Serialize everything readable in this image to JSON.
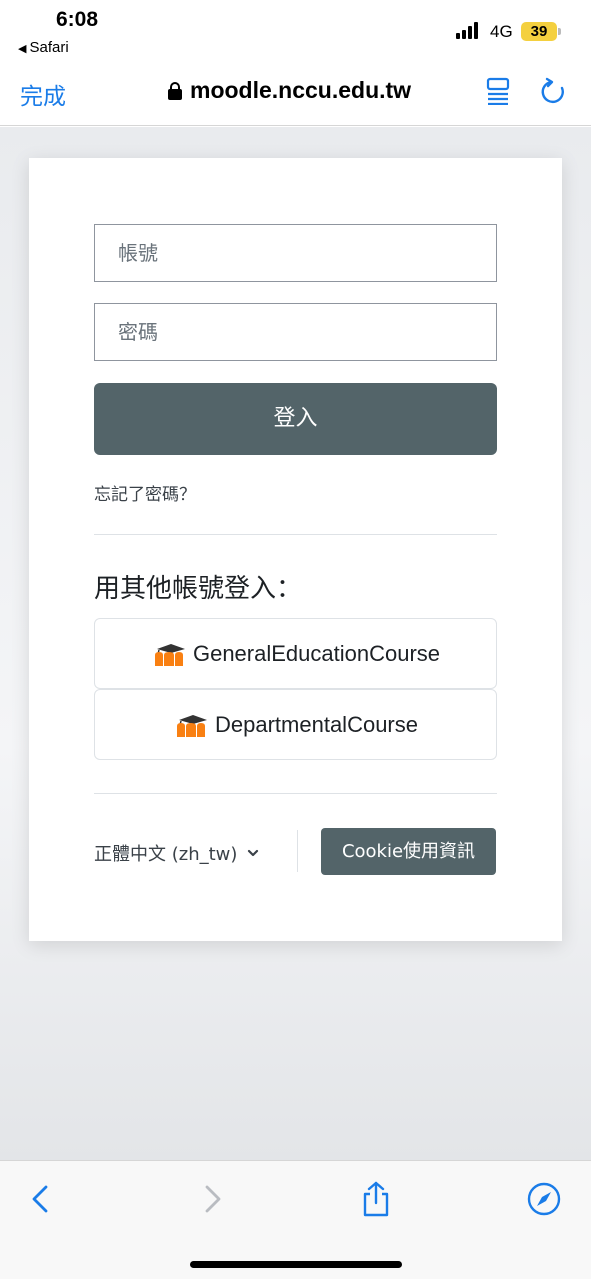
{
  "status_bar": {
    "time": "6:08",
    "back_app": "Safari",
    "network": "4G",
    "battery": "39"
  },
  "browser": {
    "done_label": "完成",
    "url": "moodle.nccu.edu.tw",
    "accent_color": "#1a7ce8"
  },
  "login": {
    "username_placeholder": "帳號",
    "password_placeholder": "密碼",
    "login_button": "登入",
    "forgot_password": "忘記了密碼？",
    "other_accounts_heading": "用其他帳號登入：",
    "identity_providers": [
      {
        "label": "GeneralEducationCourse",
        "icon": "moodle-icon"
      },
      {
        "label": "DepartmentalCourse",
        "icon": "moodle-icon"
      }
    ],
    "language": "正體中文 (zh_tw)",
    "cookie_button": "Cookie使用資訊",
    "button_color": "#536469"
  },
  "toolbar": {
    "icons": [
      "back-icon",
      "forward-icon",
      "share-icon",
      "safari-compass-icon"
    ]
  }
}
